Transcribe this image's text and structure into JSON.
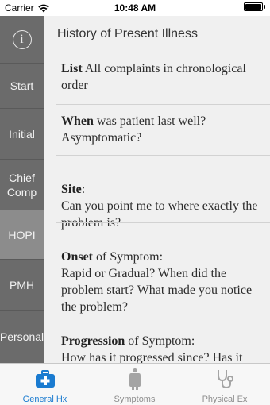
{
  "status_bar": {
    "carrier": "Carrier",
    "time": "10:48 AM"
  },
  "sidebar": {
    "items": [
      {
        "label": "Start"
      },
      {
        "label": "Initial"
      },
      {
        "label": "Chief Comp"
      },
      {
        "label": "HOPI",
        "selected": true
      },
      {
        "label": "PMH"
      },
      {
        "label": "Personal"
      }
    ]
  },
  "main": {
    "title": "History of Present Illness",
    "rows": [
      {
        "bold": "List",
        "text": " All complaints in chronological order"
      },
      {
        "bold": "When",
        "text": " was patient last well? Asymptomatic?"
      },
      {
        "bold": "Site",
        "text": ":\nCan you point me to where exactly the problem is?"
      },
      {
        "bold": "Onset",
        "text": " of Symptom:\nRapid or Gradual? When did the problem start? What made you notice the problem?"
      },
      {
        "bold": "Progression",
        "text": " of Symptom:\nHow has it progressed since? Has it increased in severity?"
      }
    ]
  },
  "tab_bar": {
    "tabs": [
      {
        "label": "General Hx",
        "active": true
      },
      {
        "label": "Symptoms"
      },
      {
        "label": "Physical Ex"
      }
    ]
  },
  "colors": {
    "accent": "#1a7bd0",
    "sidebar_bg": "#6b6b6b",
    "sidebar_selected": "#8c8c8c",
    "content_bg": "#f0f0f0"
  }
}
